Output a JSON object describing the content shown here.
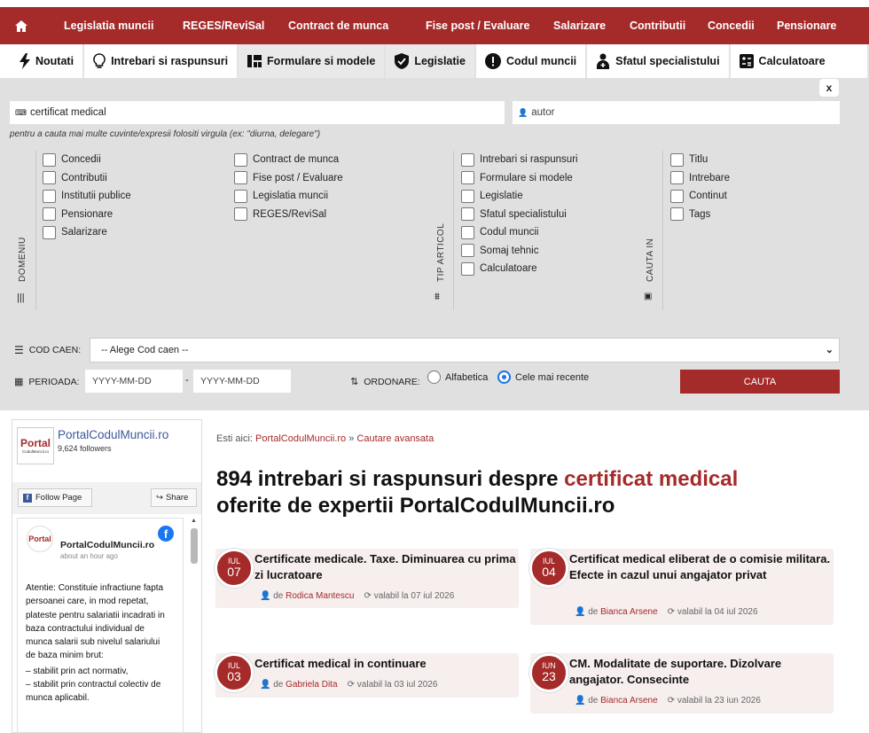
{
  "nav": {
    "items": [
      "Legislatia muncii",
      "REGES/ReviSal",
      "Contract de munca",
      "Fise post / Evaluare",
      "Salarizare",
      "Contributii",
      "Concedii",
      "Pensionare"
    ]
  },
  "tabs": [
    "Noutati",
    "Intrebari si raspunsuri",
    "Formulare si modele",
    "Legislatie",
    "Codul muncii",
    "Sfatul specialistului",
    "Calculatoare"
  ],
  "search": {
    "close": "x",
    "query": "certificat medical",
    "author_placeholder": "autor",
    "hint": "pentru a cauta mai multe cuvinte/expresii folositi virgula (ex: \"diurna, delegare\")"
  },
  "domeniu": {
    "label": "DOMENIU",
    "col1": [
      "Concedii",
      "Contributii",
      "Institutii publice",
      "Pensionare",
      "Salarizare"
    ],
    "col2": [
      "Contract de munca",
      "Fise post / Evaluare",
      "Legislatia muncii",
      "REGES/ReviSal"
    ]
  },
  "tip": {
    "label": "TIP ARTICOL",
    "items": [
      "Intrebari si raspunsuri",
      "Formulare si modele",
      "Legislatie",
      "Sfatul specialistului",
      "Codul muncii",
      "Somaj tehnic",
      "Calculatoare"
    ]
  },
  "cauta_in": {
    "label": "CAUTA IN",
    "items": [
      "Titlu",
      "Intrebare",
      "Continut",
      "Tags"
    ]
  },
  "caen": {
    "label": "COD CAEN:",
    "placeholder": "-- Alege Cod caen --"
  },
  "perioada": {
    "label": "PERIOADA:",
    "from": "YYYY-MM-DD",
    "sep": "-",
    "to": "YYYY-MM-DD"
  },
  "ordonare": {
    "label": "ORDONARE:",
    "opt1": "Alfabetica",
    "opt2": "Cele mai recente"
  },
  "button": "CAUTA",
  "fb": {
    "page": "PortalCodulMuncii.ro",
    "followers": "9,624 followers",
    "follow": "Follow Page",
    "share": "Share",
    "logo": "Portal",
    "logo_sub": "CodulMuncii.ro",
    "post_author": "PortalCodulMuncii.ro",
    "post_time": "about an hour ago",
    "post_text": "Atentie: Constituie infractiune fapta persoanei care, in mod repetat, plateste pentru salariatii incadrati in baza contractului individual de munca salarii sub nivelul salariului de baza minim brut:",
    "post_l1": "– stabilit prin act normativ,",
    "post_l2": "– stabilit prin contractul colectiv de munca aplicabil."
  },
  "crumb": {
    "prefix": "Esti aici:",
    "site": "PortalCodulMuncii.ro",
    "sep": "»",
    "page": "Cautare avansata"
  },
  "heading": {
    "pre": "894 intrebari si raspunsuri despre",
    "hl": "certificat medical",
    "post": "oferite de expertii PortalCodulMuncii.ro"
  },
  "articles": [
    {
      "month": "IUL",
      "day": "07",
      "title": "Certificate medicale. Taxe. Diminuarea cu prima zi lucratoare",
      "de": "de",
      "author": "Rodica Mantescu",
      "valid": "valabil la 07 iul 2026"
    },
    {
      "month": "IUL",
      "day": "04",
      "title": "Certificat medical eliberat de o comisie militara. Efecte in cazul unui angajator privat",
      "de": "de",
      "author": "Bianca Arsene",
      "valid": "valabil la 04 iul 2026"
    },
    {
      "month": "IUL",
      "day": "03",
      "title": "Certificat medical in continuare",
      "de": "de",
      "author": "Gabriela Dita",
      "valid": "valabil la 03 iul 2026"
    },
    {
      "month": "IUN",
      "day": "23",
      "title": "CM. Modalitate de suportare. Dizolvare angajator. Consecinte",
      "de": "de",
      "author": "Bianca Arsene",
      "valid": "valabil la 23 iun 2026"
    }
  ]
}
